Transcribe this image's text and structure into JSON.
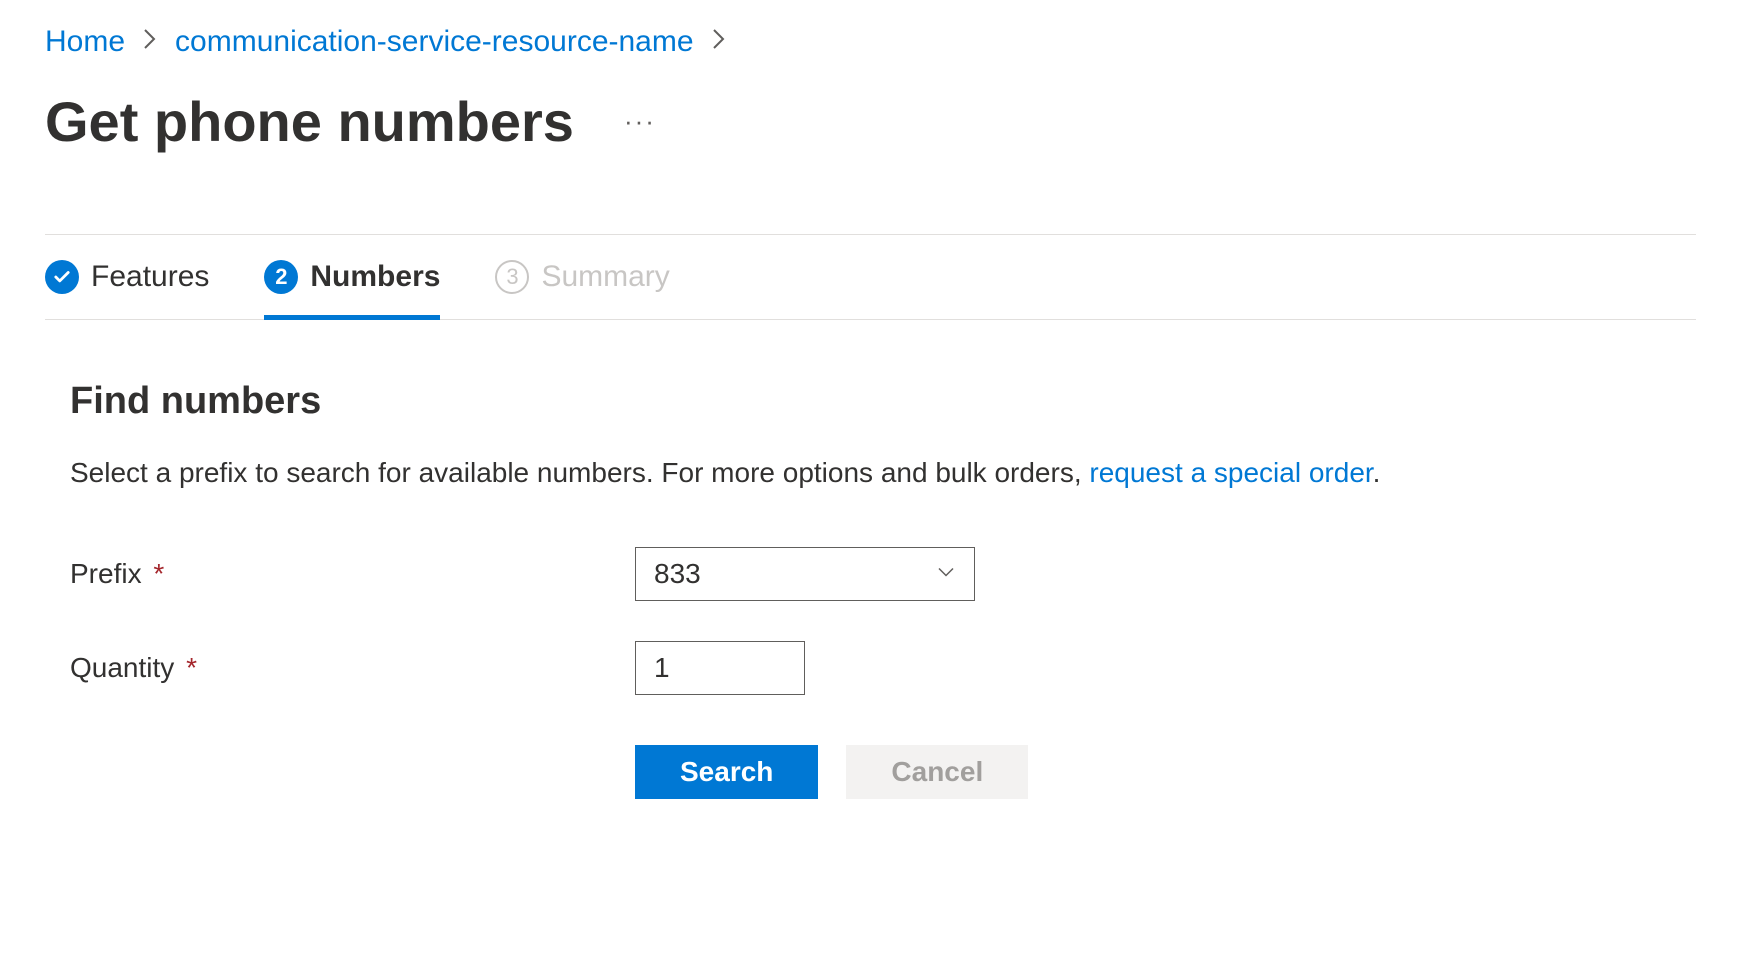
{
  "breadcrumb": {
    "items": [
      {
        "label": "Home"
      },
      {
        "label": "communication-service-resource-name"
      }
    ]
  },
  "page": {
    "title": "Get phone numbers"
  },
  "tabs": [
    {
      "label": "Features",
      "state": "completed"
    },
    {
      "label": "Numbers",
      "state": "active",
      "number": "2"
    },
    {
      "label": "Summary",
      "state": "pending",
      "number": "3"
    }
  ],
  "section": {
    "title": "Find numbers",
    "desc_prefix": "Select a prefix to search for available numbers. For more options and bulk orders, ",
    "desc_link": "request a special order",
    "desc_suffix": "."
  },
  "form": {
    "prefix_label": "Prefix",
    "prefix_value": "833",
    "quantity_label": "Quantity",
    "quantity_value": "1",
    "search_label": "Search",
    "cancel_label": "Cancel"
  }
}
